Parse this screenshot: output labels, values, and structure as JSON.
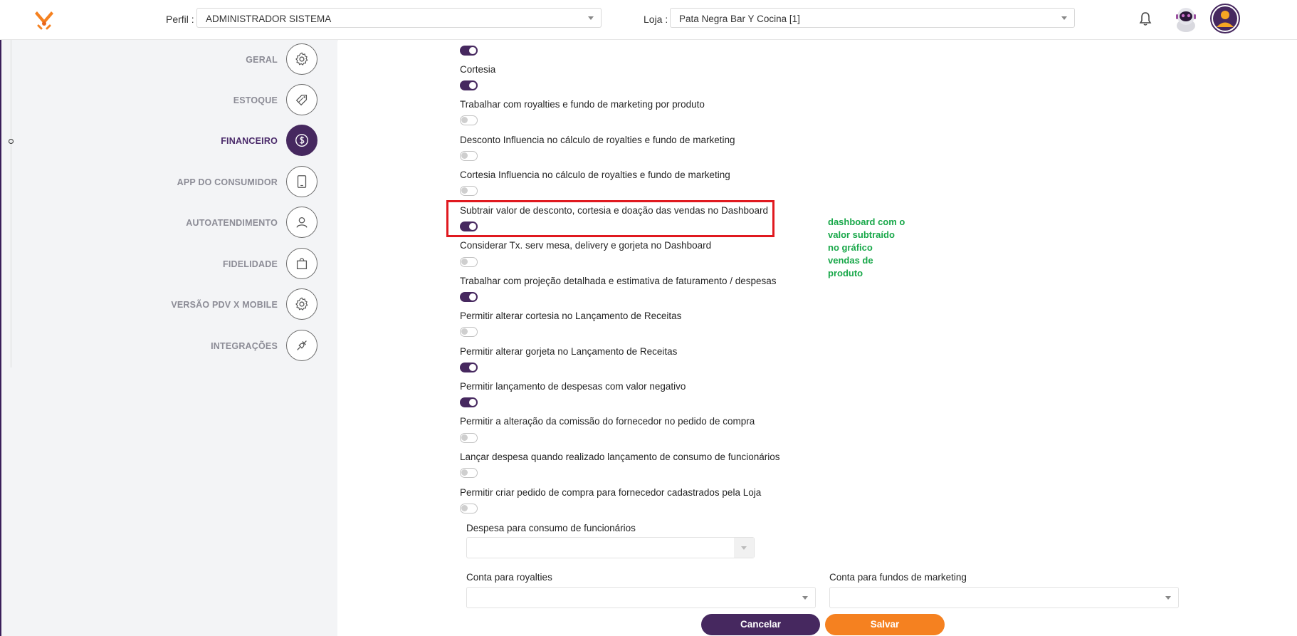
{
  "header": {
    "perfil_label": "Perfil :",
    "perfil_value": "ADMINISTRADOR SISTEMA",
    "loja_label": "Loja :",
    "loja_value": "Pata Negra Bar Y Cocina [1]"
  },
  "sidebar": {
    "items": [
      {
        "label": "GERAL",
        "icon": "gear-icon"
      },
      {
        "label": "ESTOQUE",
        "icon": "tag-icon"
      },
      {
        "label": "FINANCEIRO",
        "icon": "dollar-icon",
        "active": true
      },
      {
        "label": "APP DO CONSUMIDOR",
        "icon": "tablet-icon"
      },
      {
        "label": "AUTOATENDIMENTO",
        "icon": "user-icon"
      },
      {
        "label": "FIDELIDADE",
        "icon": "bag-icon"
      },
      {
        "label": "VERSÃO PDV X MOBILE",
        "icon": "gear-icon"
      },
      {
        "label": "INTEGRAÇÕES",
        "icon": "plug-icon"
      }
    ]
  },
  "options": [
    {
      "label": "Cortesia",
      "on": true
    },
    {
      "label": "Trabalhar com royalties e fundo de marketing por produto",
      "on": false
    },
    {
      "label": "Desconto Influencia no cálculo de royalties e fundo de marketing",
      "on": false
    },
    {
      "label": "Cortesia Influencia no cálculo de royalties e fundo de marketing",
      "on": false
    },
    {
      "label": "Subtrair valor de desconto, cortesia e doação das vendas no Dashboard",
      "on": true
    },
    {
      "label": "Considerar Tx. serv mesa, delivery e gorjeta no Dashboard",
      "on": false
    },
    {
      "label": "Trabalhar com projeção detalhada e estimativa de faturamento / despesas",
      "on": true
    },
    {
      "label": "Permitir alterar cortesia no Lançamento de Receitas",
      "on": false
    },
    {
      "label": "Permitir alterar gorjeta no Lançamento de Receitas",
      "on": true
    },
    {
      "label": "Permitir lançamento de despesas com valor negativo",
      "on": true
    },
    {
      "label": "Permitir a alteração da comissão do fornecedor no pedido de compra",
      "on": false
    },
    {
      "label": "Lançar despesa quando realizado lançamento de consumo de funcionários",
      "on": false
    },
    {
      "label": "Permitir criar pedido de compra para fornecedor cadastrados pela Loja",
      "on": false
    }
  ],
  "top_toggle_on": true,
  "annotation": "dashboard com o valor subtraído no gráfico vendas de produto",
  "fields": {
    "despesa_consumo_label": "Despesa para consumo de funcionários",
    "conta_royalties_label": "Conta para royalties",
    "conta_fundos_label": "Conta para fundos de marketing"
  },
  "buttons": {
    "cancel": "Cancelar",
    "save": "Salvar"
  },
  "colors": {
    "primary": "#46285f",
    "accent": "#f58120",
    "highlight": "#e0191f",
    "annotation": "#19a84a"
  }
}
